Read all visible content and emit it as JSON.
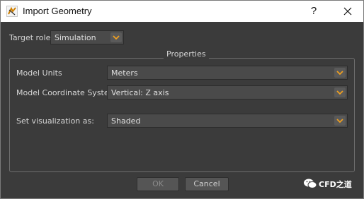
{
  "window": {
    "title": "Import Geometry",
    "help_glyph": "?",
    "accent": "#f0a020"
  },
  "target_role": {
    "label": "Target role:",
    "value": "Simulation"
  },
  "properties": {
    "title": "Properties",
    "model_units": {
      "label": "Model Units",
      "value": "Meters"
    },
    "coordinate_system": {
      "label": "Model Coordinate System:",
      "value": "Vertical: Z axis"
    },
    "visualization": {
      "label": "Set visualization as:",
      "value": "Shaded"
    }
  },
  "buttons": {
    "ok": "OK",
    "cancel": "Cancel"
  },
  "watermark": {
    "text": "CFD之道",
    "icon": "wechat-icon"
  }
}
